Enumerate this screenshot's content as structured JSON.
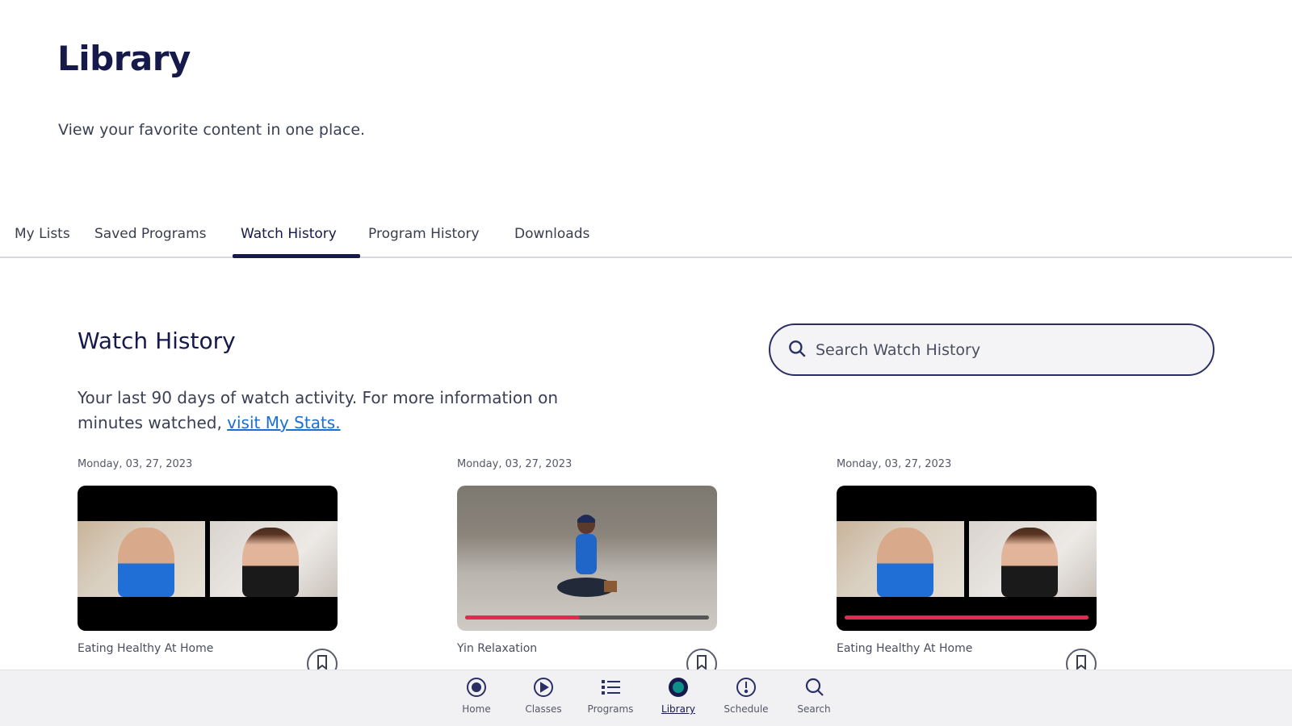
{
  "header": {
    "title": "Library",
    "subtitle": "View your favorite content in one place."
  },
  "tabs": [
    {
      "label": "My Lists"
    },
    {
      "label": "Saved Programs"
    },
    {
      "label": "Watch History",
      "active": true
    },
    {
      "label": "Program History"
    },
    {
      "label": "Downloads"
    }
  ],
  "section": {
    "title": "Watch History",
    "desc_text": "Your last 90 days of watch activity. For more information on minutes watched, ",
    "desc_link": "visit My Stats."
  },
  "search": {
    "placeholder": "Search Watch History",
    "icon": "search-icon"
  },
  "cards": [
    {
      "date": "Monday, 03, 27, 2023",
      "title": "Eating Healthy At Home",
      "thumbnail": "video-call-two-people",
      "progress": 0
    },
    {
      "date": "Monday, 03, 27, 2023",
      "title": "Yin Relaxation",
      "thumbnail": "yoga-seated-instructor",
      "progress": 0.47
    },
    {
      "date": "Monday, 03, 27, 2023",
      "title": "Eating Healthy At Home",
      "thumbnail": "video-call-two-people",
      "progress": 1.0
    }
  ],
  "bottom_nav": [
    {
      "label": "Home",
      "icon": "home-icon"
    },
    {
      "label": "Classes",
      "icon": "play-icon"
    },
    {
      "label": "Programs",
      "icon": "list-icon"
    },
    {
      "label": "Library",
      "icon": "library-icon",
      "active": true
    },
    {
      "label": "Schedule",
      "icon": "schedule-icon"
    },
    {
      "label": "Search",
      "icon": "search-icon"
    }
  ],
  "colors": {
    "primary": "#151a4a",
    "link": "#1a6fd1",
    "progress": "#e2294f",
    "library_active": "#0b5e5e"
  }
}
